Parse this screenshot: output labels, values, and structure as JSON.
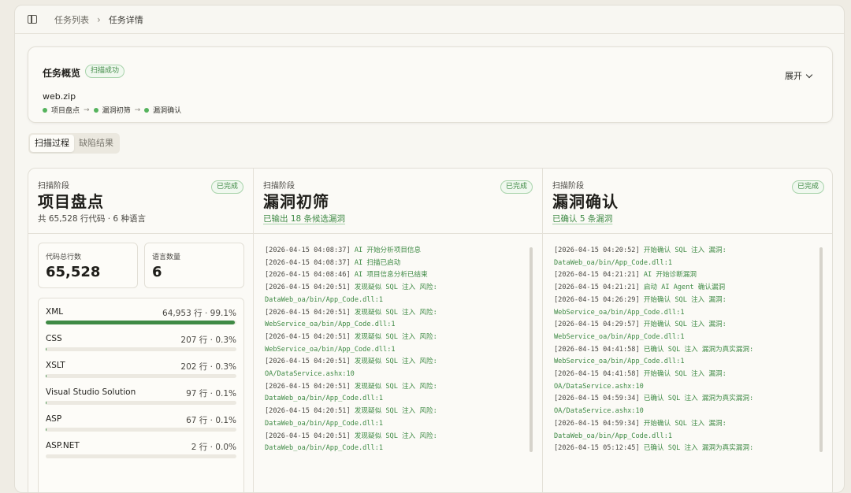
{
  "breadcrumb": [
    "任务列表",
    "任务详情"
  ],
  "overview": {
    "title": "任务概览",
    "status": "扫描成功",
    "expand_label": "展开",
    "file": "web.zip",
    "steps": [
      "项目盘点",
      "漏洞初筛",
      "漏洞确认"
    ]
  },
  "tabs": [
    "扫描过程",
    "缺陷结果"
  ],
  "stages": [
    {
      "label": "扫描阶段",
      "title": "项目盘点",
      "badge": "已完成",
      "subtitle": "共 65,528 行代码 · 6 种语言",
      "metrics": [
        {
          "label": "代码总行数",
          "value": "65,528"
        },
        {
          "label": "语言数量",
          "value": "6"
        }
      ],
      "languages": [
        {
          "name": "XML",
          "value": "64,953 行 · 99.1%",
          "fraction": 0.991
        },
        {
          "name": "CSS",
          "value": "207 行 · 0.3%",
          "fraction": 0.003
        },
        {
          "name": "XSLT",
          "value": "202 行 · 0.3%",
          "fraction": 0.003
        },
        {
          "name": "Visual Studio Solution",
          "value": "97 行 · 0.1%",
          "fraction": 0.001
        },
        {
          "name": "ASP",
          "value": "67 行 · 0.1%",
          "fraction": 0.001
        },
        {
          "name": "ASP.NET",
          "value": "2 行 · 0.0%",
          "fraction": 0.0
        }
      ]
    },
    {
      "label": "扫描阶段",
      "title": "漏洞初筛",
      "badge": "已完成",
      "subtitle": "已输出 18 条候选漏洞",
      "log": [
        {
          "ts": "[2026-04-15 04:08:37]",
          "msg": " AI 开始分析项目信息"
        },
        {
          "ts": "[2026-04-15 04:08:37]",
          "msg": " AI 扫描已启动"
        },
        {
          "ts": "[2026-04-15 04:08:46]",
          "msg": " AI 项目信息分析已结束"
        },
        {
          "ts": "[2026-04-15 04:20:51]",
          "msg": " 发现疑似 SQL 注入 风险:"
        },
        {
          "ts": "",
          "msg": "DataWeb_oa/bin/App_Code.dll:1"
        },
        {
          "ts": "[2026-04-15 04:20:51]",
          "msg": " 发现疑似 SQL 注入 风险:"
        },
        {
          "ts": "",
          "msg": "WebService_oa/bin/App_Code.dll:1"
        },
        {
          "ts": "[2026-04-15 04:20:51]",
          "msg": " 发现疑似 SQL 注入 风险:"
        },
        {
          "ts": "",
          "msg": "WebService_oa/bin/App_Code.dll:1"
        },
        {
          "ts": "[2026-04-15 04:20:51]",
          "msg": " 发现疑似 SQL 注入 风险:"
        },
        {
          "ts": "",
          "msg": "OA/DataService.ashx:10"
        },
        {
          "ts": "[2026-04-15 04:20:51]",
          "msg": " 发现疑似 SQL 注入 风险:"
        },
        {
          "ts": "",
          "msg": "DataWeb_oa/bin/App_Code.dll:1"
        },
        {
          "ts": "[2026-04-15 04:20:51]",
          "msg": " 发现疑似 SQL 注入 风险:"
        },
        {
          "ts": "",
          "msg": "DataWeb_oa/bin/App_Code.dll:1"
        },
        {
          "ts": "[2026-04-15 04:20:51]",
          "msg": " 发现疑似 SQL 注入 风险:"
        },
        {
          "ts": "",
          "msg": "DataWeb_oa/bin/App_Code.dll:1"
        }
      ]
    },
    {
      "label": "扫描阶段",
      "title": "漏洞确认",
      "badge": "已完成",
      "subtitle": "已确认 5 条漏洞",
      "log": [
        {
          "ts": "[2026-04-15 04:20:52]",
          "msg": " 开始确认 SQL 注入 漏洞:"
        },
        {
          "ts": "",
          "msg": "DataWeb_oa/bin/App_Code.dll:1"
        },
        {
          "ts": "[2026-04-15 04:21:21]",
          "msg": " AI 开始诊断漏洞"
        },
        {
          "ts": "[2026-04-15 04:21:21]",
          "msg": " 启动 AI Agent 确认漏洞"
        },
        {
          "ts": "[2026-04-15 04:26:29]",
          "msg": " 开始确认 SQL 注入 漏洞:"
        },
        {
          "ts": "",
          "msg": "WebService_oa/bin/App_Code.dll:1"
        },
        {
          "ts": "[2026-04-15 04:29:57]",
          "msg": " 开始确认 SQL 注入 漏洞:"
        },
        {
          "ts": "",
          "msg": "WebService_oa/bin/App_Code.dll:1"
        },
        {
          "ts": "[2026-04-15 04:41:58]",
          "msg": " 已确认 SQL 注入 漏洞为真实漏洞:"
        },
        {
          "ts": "",
          "msg": "WebService_oa/bin/App_Code.dll:1"
        },
        {
          "ts": "[2026-04-15 04:41:58]",
          "msg": " 开始确认 SQL 注入 漏洞:"
        },
        {
          "ts": "",
          "msg": "OA/DataService.ashx:10"
        },
        {
          "ts": "[2026-04-15 04:59:34]",
          "msg": " 已确认 SQL 注入 漏洞为真实漏洞:"
        },
        {
          "ts": "",
          "msg": "OA/DataService.ashx:10"
        },
        {
          "ts": "[2026-04-15 04:59:34]",
          "msg": " 开始确认 SQL 注入 漏洞:"
        },
        {
          "ts": "",
          "msg": "DataWeb_oa/bin/App_Code.dll:1"
        },
        {
          "ts": "[2026-04-15 05:12:45]",
          "msg": " 已确认 SQL 注入 漏洞为真实漏洞:"
        }
      ]
    }
  ]
}
